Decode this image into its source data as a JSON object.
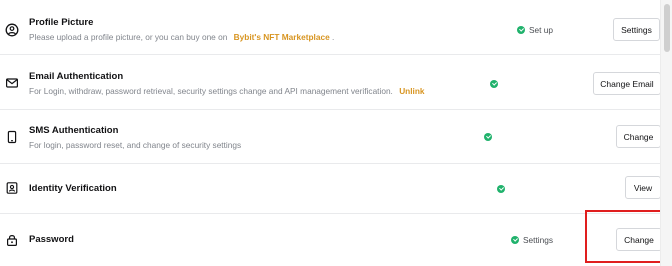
{
  "rows": {
    "profile": {
      "title": "Profile Picture",
      "desc": "Please upload a profile picture, or you can buy one on",
      "desc_link": "Bybit's NFT Marketplace",
      "desc_suffix": ".",
      "status": "Set up",
      "button": "Settings",
      "icon": "avatar-icon"
    },
    "email": {
      "title": "Email Authentication",
      "desc": "For Login, withdraw, password retrieval, security settings change and API management verification.",
      "desc_link": "Unlink",
      "button": "Change Email",
      "icon": "mail-icon"
    },
    "sms": {
      "title": "SMS Authentication",
      "desc": "For login, password reset, and change of security settings",
      "button": "Change",
      "icon": "phone-icon"
    },
    "identity": {
      "title": "Identity Verification",
      "button": "View",
      "icon": "id-card-icon"
    },
    "password": {
      "title": "Password",
      "status": "Settings",
      "button": "Change",
      "icon": "lock-icon"
    }
  },
  "colors": {
    "accent_link": "#d89521",
    "status_check": "#20b26c",
    "highlight": "#e01e1e"
  }
}
